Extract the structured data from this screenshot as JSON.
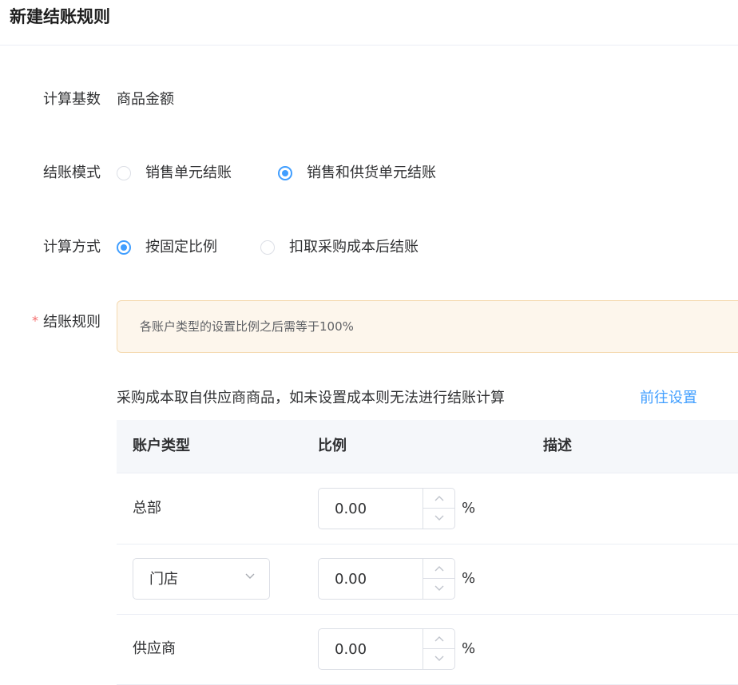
{
  "page": {
    "title": "新建结账规则"
  },
  "form": {
    "base": {
      "label": "计算基数",
      "value": "商品金额"
    },
    "mode": {
      "label": "结账模式",
      "options": [
        {
          "label": "销售单元结账",
          "checked": false
        },
        {
          "label": "销售和供货单元结账",
          "checked": true
        }
      ]
    },
    "method": {
      "label": "计算方式",
      "options": [
        {
          "label": "按固定比例",
          "checked": true
        },
        {
          "label": "扣取采购成本后结账",
          "checked": false
        }
      ]
    },
    "rules": {
      "label": "结账规则",
      "required_mark": "*",
      "alert": "各账户类型的设置比例之后需等于100%",
      "notice": "采购成本取自供应商商品，如未设置成本则无法进行结账计算",
      "notice_link": "前往设置"
    }
  },
  "table": {
    "headers": {
      "account_type": "账户类型",
      "ratio": "比例",
      "description": "描述"
    },
    "rows": [
      {
        "account_type": "总部",
        "ratio": "0.00",
        "unit": "%",
        "editable_type": false
      },
      {
        "account_type": "门店",
        "ratio": "0.00",
        "unit": "%",
        "editable_type": true
      },
      {
        "account_type": "供应商",
        "ratio": "0.00",
        "unit": "%",
        "editable_type": false
      }
    ]
  },
  "icons": {
    "select_arrow": "chevron-down-icon",
    "step_up": "chevron-up-icon",
    "step_down": "chevron-down-icon"
  },
  "colors": {
    "primary": "#409eff",
    "required": "#f56c6c",
    "alert_bg": "#fdf6ec",
    "alert_border": "#f5dab1"
  }
}
